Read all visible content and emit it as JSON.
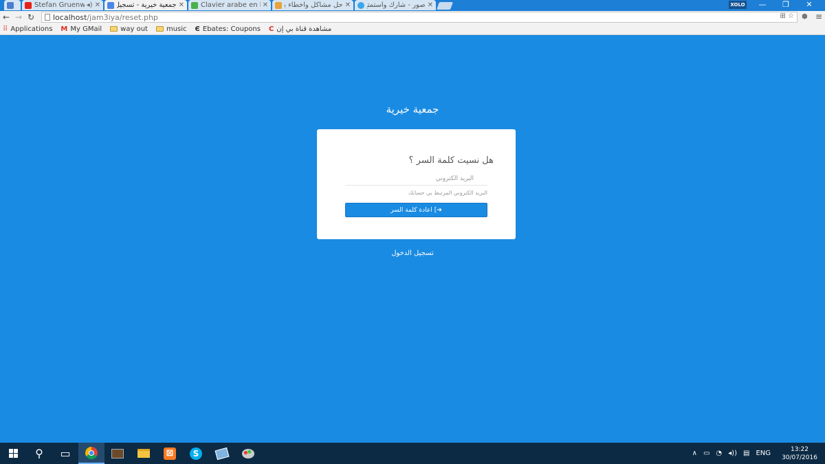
{
  "browser": {
    "tabs": [
      {
        "title": "Stefan Gruenwald",
        "active": false,
        "fav_color": "#e62117"
      },
      {
        "title": "جمعية خيرية - تسجيل",
        "active": true,
        "fav_color": "#4a86e8"
      },
      {
        "title": "Clavier arabe en ligne",
        "active": false,
        "fav_color": "#4caf50"
      },
      {
        "title": "حل مشاكل واخطاء برنامج",
        "active": false,
        "fav_color": "#e8a33a"
      },
      {
        "title": "صور - شارك واستمتع",
        "active": false,
        "fav_color": "#3aa7e8"
      }
    ],
    "profile": "XOLO",
    "url_host": "localhost",
    "url_path": "/jam3iya/reset.php"
  },
  "bookmarks": [
    {
      "label": "Applications",
      "icon": "apps-grid-icon"
    },
    {
      "label": "My GMail",
      "icon": "gmail-icon"
    },
    {
      "label": "way out",
      "icon": "folder-icon"
    },
    {
      "label": "music",
      "icon": "folder-icon"
    },
    {
      "label": "Ebates: Coupons",
      "icon": "ebates-icon"
    },
    {
      "label": "مشاهدة قناة بي إن",
      "icon": "channel-icon"
    }
  ],
  "page": {
    "site_title": "جمعية خيرية",
    "heading": "هل نسيت كلمة السر ؟",
    "email_placeholder": "البريد الكتروني",
    "hint": "البريد الكتروني المرتبط بي حسابك",
    "submit_label": "اعادة كلمة السر",
    "login_link": "تسجيل الدخول"
  },
  "taskbar": {
    "language": "ENG",
    "time": "13:22",
    "date": "30/07/2016"
  }
}
